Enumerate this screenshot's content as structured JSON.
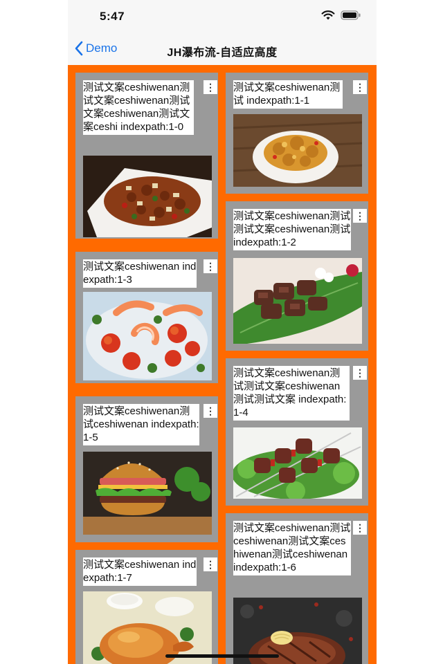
{
  "status_bar": {
    "time": "5:47"
  },
  "nav": {
    "back_label": "Demo",
    "title": "JH瀑布流-自适应高度"
  },
  "more_label": "⋮",
  "cells": [
    {
      "text": "测试文案ceshiwenan测试文案ceshiwenan测试文案ceshiwenan测试文案ceshi indexpath:1-0",
      "image": "kung-pao-chicken-photo"
    },
    {
      "text": "测试文案ceshiwenan测试 indexpath:1-1",
      "image": "fried-chicken-photo"
    },
    {
      "text": "测试文案ceshiwenan测试测试文案ceshiwenan测试 indexpath:1-2",
      "image": "grilled-meat-on-leaf-photo"
    },
    {
      "text": "测试文案ceshiwenan indexpath:1-3",
      "image": "shrimp-salad-photo"
    },
    {
      "text": "测试文案ceshiwenan测试测试文案ceshiwenan测试测试文案 indexpath:1-4",
      "image": "meat-skewers-photo"
    },
    {
      "text": "测试文案ceshiwenan测试ceshiwenan indexpath:1-5",
      "image": "burger-photo"
    },
    {
      "text": "测试文案ceshiwenan测试ceshiwenan测试文案ceshiwenan测试ceshiwenan indexpath:1-6",
      "image": "steak-photo"
    },
    {
      "text": "测试文案ceshiwenan indexpath:1-7",
      "image": "roast-duck-photo"
    }
  ]
}
